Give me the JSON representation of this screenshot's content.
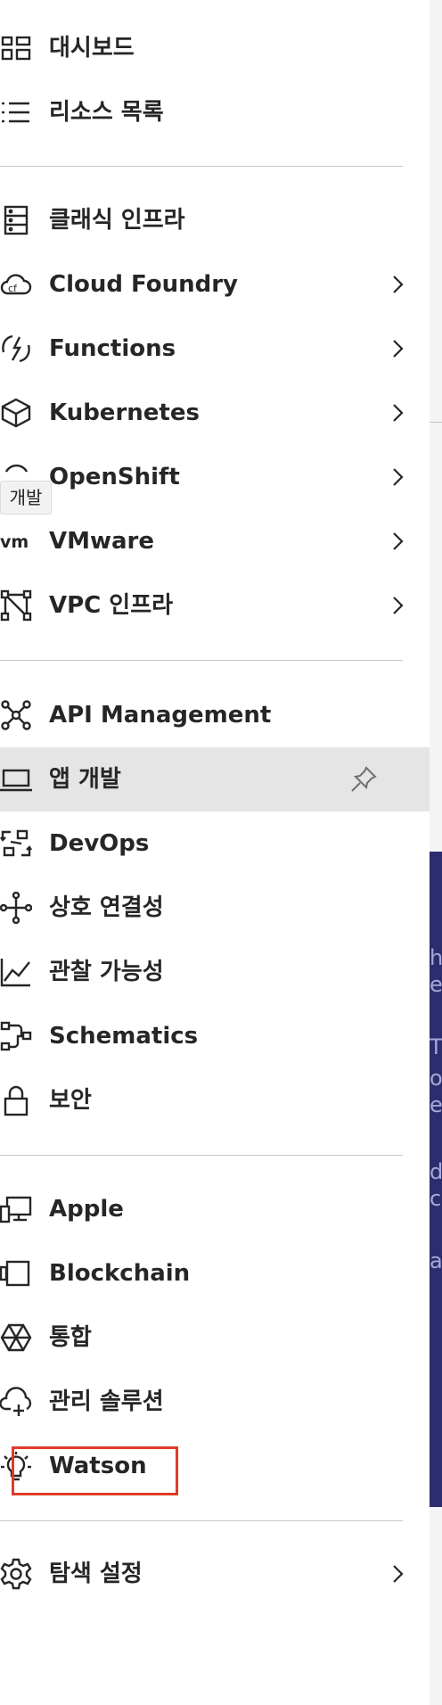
{
  "menu": {
    "groups": [
      {
        "items": [
          {
            "label": "대시보드",
            "icon": "dashboard-icon"
          },
          {
            "label": "리소스 목록",
            "icon": "list-icon"
          }
        ]
      },
      {
        "items": [
          {
            "label": "클래식 인프라",
            "icon": "server-icon"
          },
          {
            "label": "Cloud Foundry",
            "icon": "cloud-foundry-icon",
            "chevron": true
          },
          {
            "label": "Functions",
            "icon": "functions-icon",
            "chevron": true
          },
          {
            "label": "Kubernetes",
            "icon": "kubernetes-icon",
            "chevron": true
          },
          {
            "label": "OpenShift",
            "icon": "openshift-icon",
            "chevron": true
          },
          {
            "label": "VMware",
            "icon": "vmware-icon",
            "chevron": true
          },
          {
            "label": "VPC 인프라",
            "icon": "vpc-icon",
            "chevron": true
          }
        ]
      },
      {
        "items": [
          {
            "label": "API Management",
            "icon": "api-icon"
          },
          {
            "label": "앱 개발",
            "icon": "laptop-icon",
            "active": true,
            "pin": true
          },
          {
            "label": "DevOps",
            "icon": "devops-icon"
          },
          {
            "label": "상호 연결성",
            "icon": "interconnect-icon"
          },
          {
            "label": "관찰 가능성",
            "icon": "chart-line-icon"
          },
          {
            "label": "Schematics",
            "icon": "schematics-icon"
          },
          {
            "label": "보안",
            "icon": "lock-icon"
          }
        ]
      },
      {
        "items": [
          {
            "label": "Apple",
            "icon": "apple-devices-icon"
          },
          {
            "label": "Blockchain",
            "icon": "blockchain-icon"
          },
          {
            "label": "통합",
            "icon": "integration-icon"
          },
          {
            "label": "관리 솔루션",
            "icon": "cloud-add-icon"
          },
          {
            "label": "Watson",
            "icon": "watson-icon"
          }
        ]
      },
      {
        "items": [
          {
            "label": "탐색 설정",
            "icon": "settings-icon",
            "chevron": true
          }
        ]
      }
    ]
  },
  "tooltip": {
    "text": "개발"
  },
  "colors": {
    "active_bg": "#e5e5e5",
    "divider": "#c6c6c6",
    "highlight_border": "#e03b2a",
    "background_panel": "#2b2d6e"
  }
}
